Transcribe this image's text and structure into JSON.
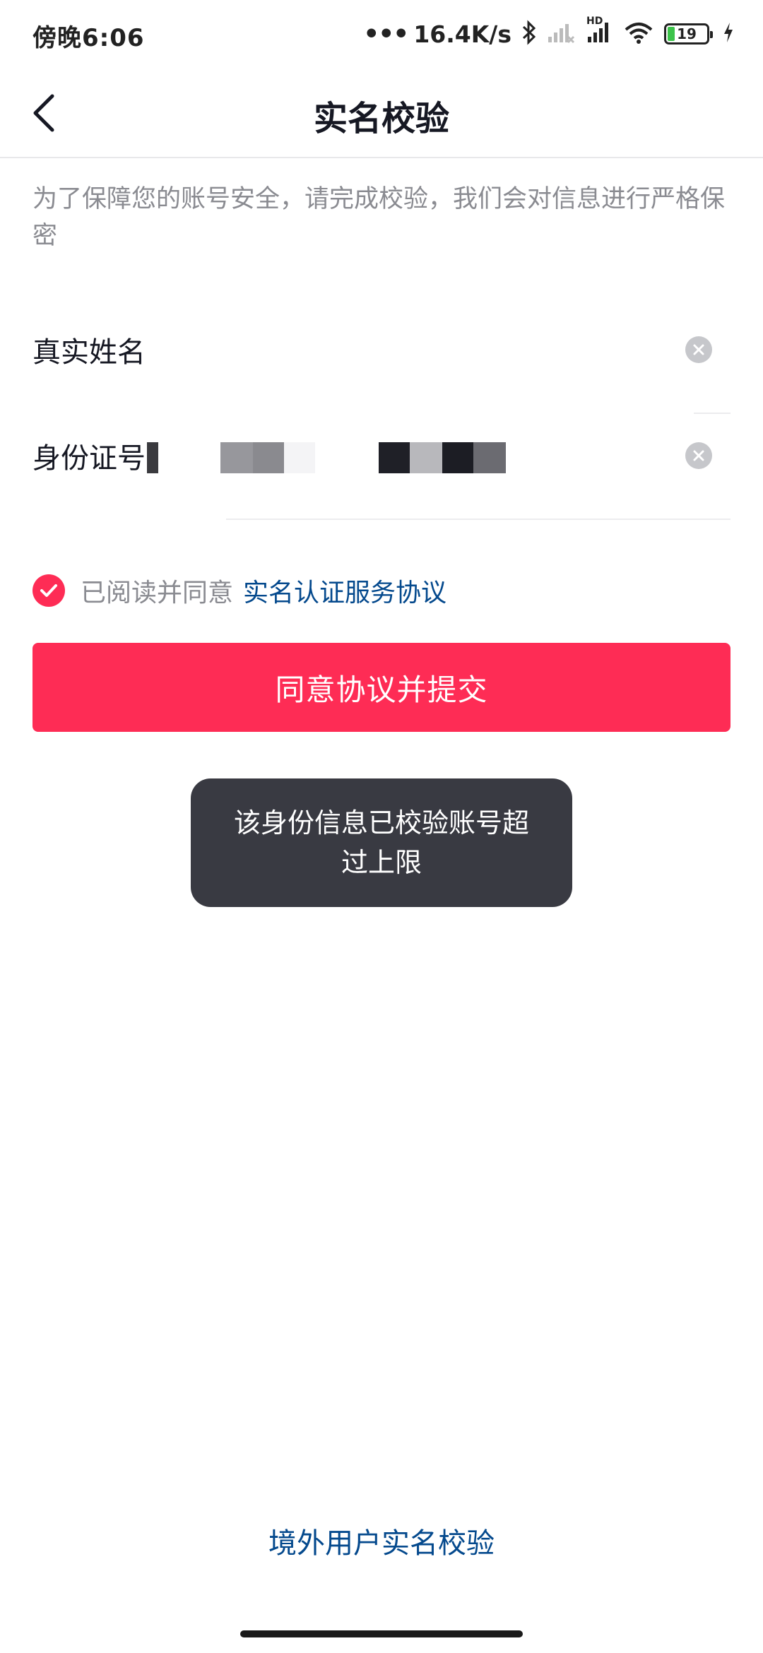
{
  "status_bar": {
    "time": "傍晚6:06",
    "dots": "•••",
    "net_speed": "16.4K/s",
    "hd_label": "HD",
    "battery": "19"
  },
  "nav": {
    "title": "实名校验"
  },
  "tip": "为了保障您的账号安全，请完成校验，我们会对信息进行严格保密",
  "form": {
    "name_label": "真实姓名",
    "id_label": "身份证号"
  },
  "agreement": {
    "text": "已阅读并同意",
    "link": "实名认证服务协议"
  },
  "submit_label": "同意协议并提交",
  "toast": "该身份信息已校验账号超过上限",
  "overseas_link": "境外用户实名校验",
  "colors": {
    "accent": "#fe2c55",
    "link": "#04498d",
    "toast_bg": "#393a42"
  }
}
